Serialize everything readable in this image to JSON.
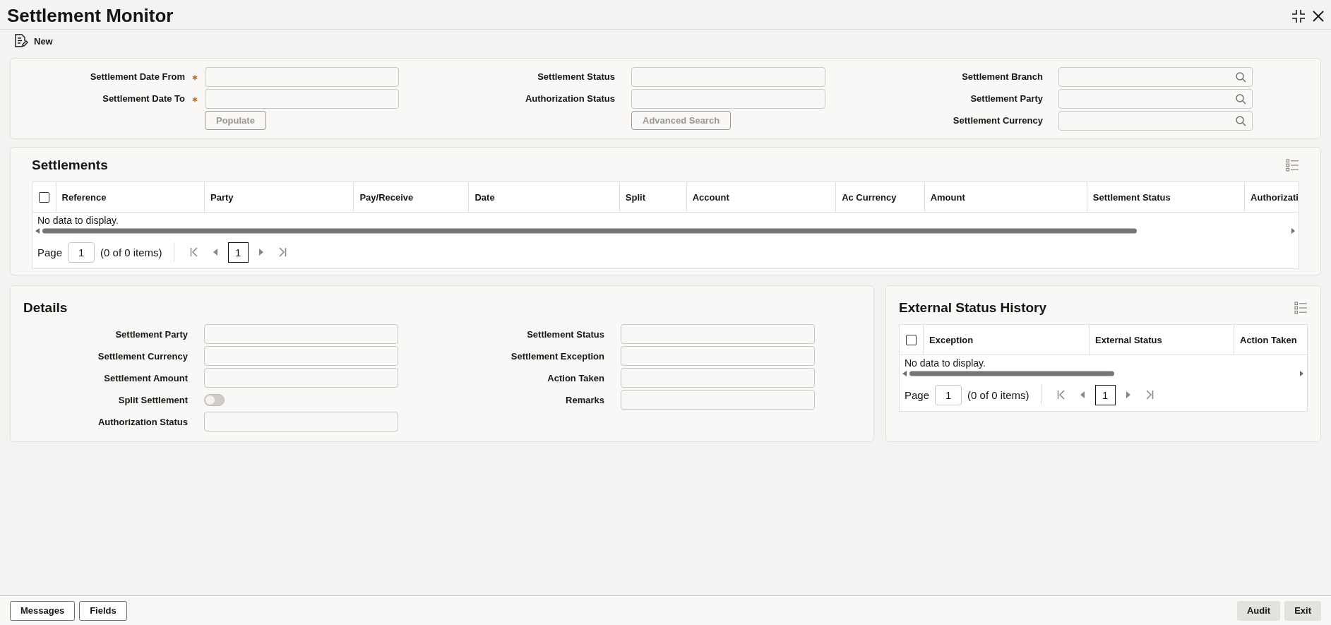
{
  "window": {
    "title": "Settlement Monitor"
  },
  "toolbar": {
    "new_label": "New"
  },
  "search": {
    "columns": [
      {
        "fields": [
          {
            "label": "Settlement Date From",
            "required": true,
            "kind": "text"
          },
          {
            "label": "Settlement Date To",
            "required": true,
            "kind": "text"
          }
        ],
        "button": {
          "label": "Populate",
          "disabled": true
        }
      },
      {
        "fields": [
          {
            "label": "Settlement Status",
            "required": false,
            "kind": "text"
          },
          {
            "label": "Authorization Status",
            "required": false,
            "kind": "text"
          }
        ],
        "button": {
          "label": "Advanced Search",
          "disabled": true
        }
      },
      {
        "fields": [
          {
            "label": "Settlement Branch",
            "required": false,
            "kind": "lookup"
          },
          {
            "label": "Settlement Party",
            "required": false,
            "kind": "lookup"
          },
          {
            "label": "Settlement Currency",
            "required": false,
            "kind": "lookup"
          }
        ]
      }
    ]
  },
  "settlements": {
    "title": "Settlements",
    "select_all_checked": false,
    "columns": [
      "Reference",
      "Party",
      "Pay/Receive",
      "Date",
      "Split",
      "Account",
      "Ac Currency",
      "Amount",
      "Settlement Status",
      "Authorizati"
    ],
    "empty_text": "No data to display.",
    "pager": {
      "page_label": "Page",
      "page_value": "1",
      "items_text": "(0 of 0 items)",
      "current_page": "1"
    }
  },
  "details": {
    "title": "Details",
    "left": [
      {
        "label": "Settlement Party",
        "kind": "text"
      },
      {
        "label": "Settlement Currency",
        "kind": "text"
      },
      {
        "label": "Settlement Amount",
        "kind": "text"
      },
      {
        "label": "Split Settlement",
        "kind": "toggle",
        "on": false
      },
      {
        "label": "Authorization Status",
        "kind": "text"
      }
    ],
    "right": [
      {
        "label": "Settlement Status",
        "kind": "text"
      },
      {
        "label": "Settlement Exception",
        "kind": "text"
      },
      {
        "label": "Action Taken",
        "kind": "text"
      },
      {
        "label": "Remarks",
        "kind": "text"
      }
    ]
  },
  "external_status_history": {
    "title": "External Status History",
    "select_all_checked": false,
    "columns": [
      "Exception",
      "External Status",
      "Action Taken"
    ],
    "empty_text": "No data to display.",
    "pager": {
      "page_label": "Page",
      "page_value": "1",
      "items_text": "(0 of 0 items)",
      "current_page": "1"
    }
  },
  "footer": {
    "buttons": [
      {
        "label": "Messages",
        "kind": "outline"
      },
      {
        "label": "Fields",
        "kind": "outline"
      },
      {
        "label": "Audit",
        "kind": "filled"
      },
      {
        "label": "Exit",
        "kind": "filled"
      }
    ]
  }
}
